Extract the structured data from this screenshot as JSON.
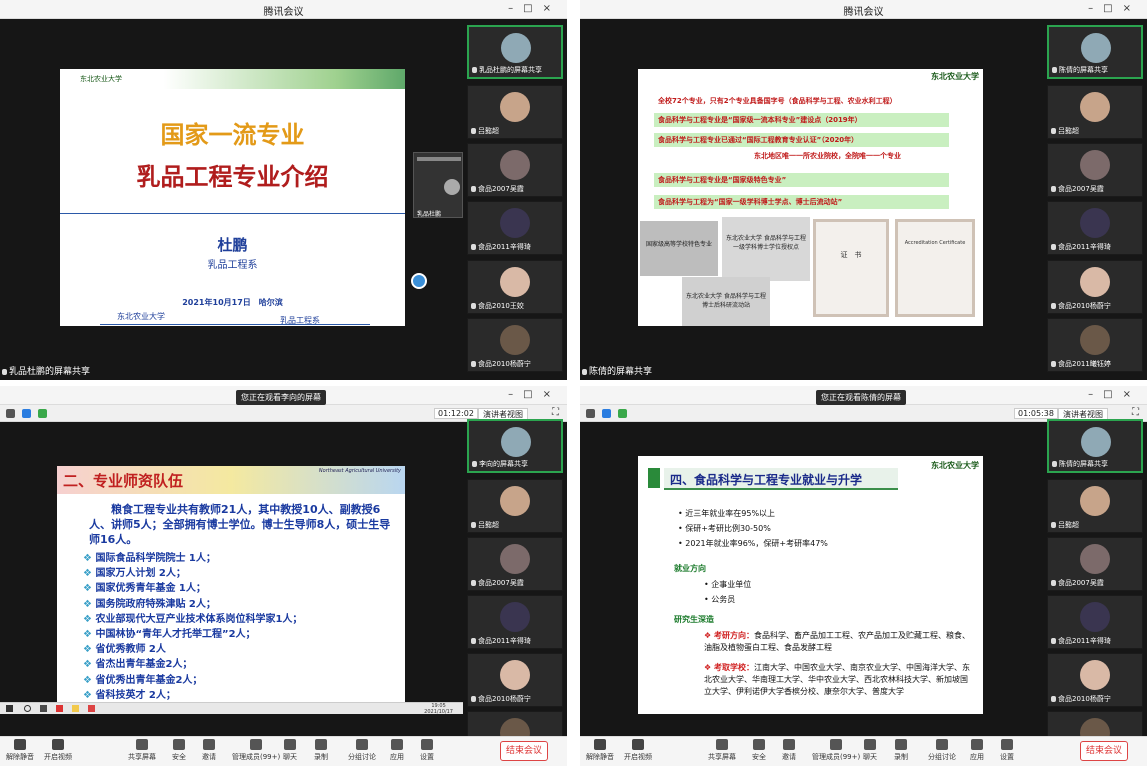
{
  "windows": [
    {
      "title": "腾讯会议",
      "share_label": "乳品杜鹏的屏幕共享"
    },
    {
      "title": "腾讯会议",
      "share_label": "陈倩的屏幕共享"
    },
    {
      "watching": "您正在观看李向的屏幕",
      "timer": "01:12:02",
      "speaker_view": "演讲者视图"
    },
    {
      "watching": "您正在观看陈倩的屏幕",
      "timer": "01:05:38",
      "speaker_view": "演讲者视图"
    }
  ],
  "slide1": {
    "logo": "东北农业大学",
    "title1": "国家一流专业",
    "title2": "乳品工程专业介绍",
    "author": "杜鹏",
    "dept": "乳品工程系",
    "date": "2021年10月17日　哈尔滨",
    "footer_left": "东北农业大学",
    "footer_right": "乳品工程系",
    "mini_label": "乳品杜鹏"
  },
  "slide2": {
    "logo": "东北农业大学",
    "line0": "全校72个专业，只有2个专业具备国字号（食品科学与工程、农业水利工程）",
    "box1": "食品科学与工程专业是“国家级一流本科专业”建设点（2019年）",
    "box2": "食品科学与工程专业已通过“国际工程教育专业认证”（2020年）",
    "note": "东北地区唯一一所农业院校，全院唯一一个专业",
    "box3": "食品科学与工程专业是“国家级特色专业”",
    "box4": "食品科学与工程为“国家一级学科博士学点、博士后流动站”",
    "plaque1": "国家级高等学校特色专业",
    "plaque2": "东北农业大学 食品科学与工程 一级学科博士学位授权点",
    "plaque3": "东北农业大学 食品科学与工程 博士后科研流动站",
    "cert1": "证　书",
    "cert2": "Accreditation Certificate"
  },
  "slide3": {
    "heading": "二、专业师资队伍",
    "logo": "Northeast Agricultural University",
    "para": "粮食工程专业共有教师21人，其中教授10人、副教授6人、讲师5人；全部拥有博士学位。博士生导师8人，硕士生导师16人。",
    "items": [
      "国际食品科学院院士 1人；",
      "国家万人计划 2人；",
      "国家优秀青年基金 1人；",
      "国务院政府特殊津贴 2人；",
      "农业部现代大豆产业技术体系岗位科学家1人；",
      "中国林协“青年人才托举工程”2人；",
      "省优秀教师 2人",
      "省杰出青年基金2人；",
      "省优秀出青年基金2人；",
      "省科技英才 2人；"
    ],
    "taskbar_time": "19:05",
    "taskbar_date": "2021/10/17"
  },
  "slide4": {
    "heading": "四、食品科学与工程专业就业与升学",
    "logo": "东北农业大学",
    "bullets": [
      "近三年就业率在95%以上",
      "保研+考研比例30-50%",
      "2021年就业率96%，保研+考研率47%"
    ],
    "sec1": "就业方向",
    "sub1": [
      "企事业单位",
      "公务员"
    ],
    "sec2": "研究生深造",
    "kao_label": "考研方向：",
    "kao_text": "食品科学、畜产品加工工程、农产品加工及贮藏工程、粮食、油脂及植物蛋白工程、食品发酵工程",
    "xiao_label": "考取学校：",
    "xiao_text": "江南大学、中国农业大学、南京农业大学、中国海洋大学、东北农业大学、华南理工大学、华中农业大学、西北农林科技大学、新加坡国立大学、伊利诺伊大学香槟分校、康奈尔大学、普度大学"
  },
  "strips": [
    [
      "乳品杜鹏的屏幕共享",
      "吕懿超",
      "食品2007吴霞",
      "食品2011辛得琦",
      "食品2010王姣",
      "食品2010杨蔚宁"
    ],
    [
      "陈倩的屏幕共享",
      "吕懿超",
      "食品2007吴霞",
      "食品2011辛得琦",
      "食品2010杨蔚宁",
      "食品2011曦钰婷"
    ],
    [
      "李向的屏幕共享",
      "吕懿超",
      "食品2007吴霞",
      "食品2011辛得琦",
      "食品2010杨蔚宁",
      ""
    ],
    [
      "陈倩的屏幕共享",
      "吕懿超",
      "食品2007吴霞",
      "食品2011辛得琦",
      "食品2010杨蔚宁",
      ""
    ]
  ],
  "toolbar": {
    "mute": "解除静音",
    "video": "开启视频",
    "share": "共享屏幕",
    "security": "安全",
    "invite": "邀请",
    "members": "管理成员(99+)",
    "chat": "聊天",
    "record": "录制",
    "breakout": "分组讨论",
    "apps": "应用",
    "settings": "设置",
    "end": "结束会议"
  }
}
